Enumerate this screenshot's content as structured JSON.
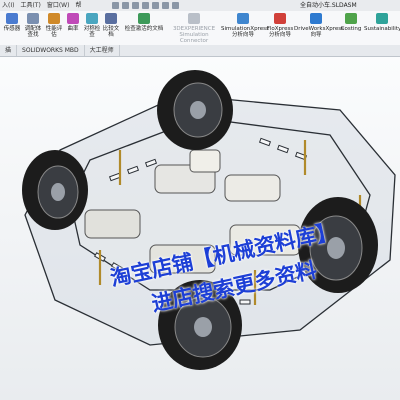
{
  "titlebar": {
    "menu": [
      "入(I)",
      "工具(T)",
      "窗口(W)",
      "帮"
    ],
    "doc_title": "全自动小车.SLDASM"
  },
  "ribbon": {
    "buttons": [
      {
        "label": "传感器",
        "label2": "",
        "icon_color": "#4a7bd0",
        "dim": false
      },
      {
        "label": "调配体",
        "label2": "查找",
        "icon_color": "#7a8fb0",
        "dim": false
      },
      {
        "label": "性能评",
        "label2": "估",
        "icon_color": "#d08a2a",
        "dim": false
      },
      {
        "label": "曲率",
        "label2": "",
        "icon_color": "#c04ab8",
        "dim": false
      },
      {
        "label": "对称检",
        "label2": "查",
        "icon_color": "#4aa6c0",
        "dim": false
      },
      {
        "label": "比较文",
        "label2": "档",
        "icon_color": "#5a6fa0",
        "dim": false
      },
      {
        "label": "检查激活的文档",
        "label2": "",
        "icon_color": "#3d9a5a",
        "dim": false
      },
      {
        "label": "3DEXPERIENCE",
        "label2": "Simulation Connector",
        "icon_color": "#b9bfc8",
        "dim": true
      },
      {
        "label": "SimulationXpress",
        "label2": "分析向导",
        "icon_color": "#3f86cf",
        "dim": false
      },
      {
        "label": "FloXpress",
        "label2": "分析向导",
        "icon_color": "#d1403a",
        "dim": false
      },
      {
        "label": "DriveWorksXpress",
        "label2": "向导",
        "icon_color": "#2e7ad0",
        "dim": false
      },
      {
        "label": "Costing",
        "label2": "",
        "icon_color": "#4fa34a",
        "dim": false
      },
      {
        "label": "Sustainability",
        "label2": "",
        "icon_color": "#2fa39a",
        "dim": false
      }
    ]
  },
  "tabs": [
    "描",
    "SOLIDWORKS MBD",
    "大工程师"
  ],
  "watermark": {
    "line1": "淘宝店铺【机械资料库】",
    "line2": "进店搜索更多资料"
  }
}
